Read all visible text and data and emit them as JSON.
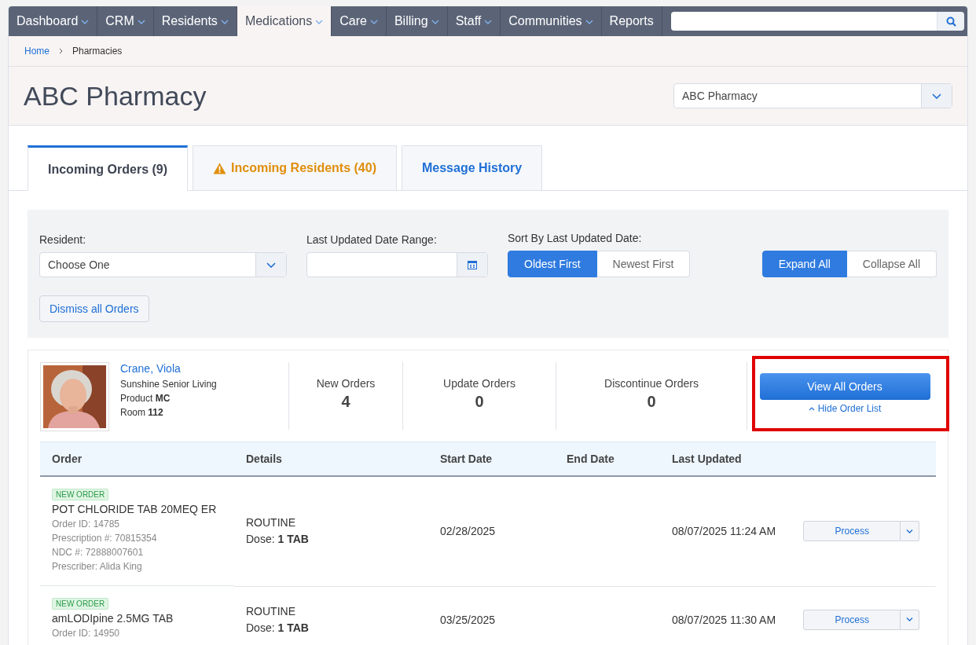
{
  "nav": {
    "items": [
      {
        "label": "Dashboard",
        "dropdown": true,
        "selected": false
      },
      {
        "label": "CRM",
        "dropdown": true,
        "selected": false
      },
      {
        "label": "Residents",
        "dropdown": true,
        "selected": false
      },
      {
        "label": "Medications",
        "dropdown": true,
        "selected": true
      },
      {
        "label": "Care",
        "dropdown": true,
        "selected": false
      },
      {
        "label": "Billing",
        "dropdown": true,
        "selected": false
      },
      {
        "label": "Staff",
        "dropdown": true,
        "selected": false
      },
      {
        "label": "Communities",
        "dropdown": true,
        "selected": false
      },
      {
        "label": "Reports",
        "dropdown": false,
        "selected": false
      }
    ]
  },
  "breadcrumb": [
    "Home",
    "Pharmacies"
  ],
  "page_title": "ABC Pharmacy",
  "pharmacy_select": {
    "value": "ABC Pharmacy"
  },
  "tabs": [
    {
      "label": "Incoming Orders (9)",
      "kind": "plain",
      "selected": true
    },
    {
      "label": "Incoming Residents (40)",
      "kind": "warning",
      "selected": false
    },
    {
      "label": "Message History",
      "kind": "plain",
      "selected": false
    }
  ],
  "filters": {
    "resident": {
      "label": "Resident:",
      "value": "Choose One"
    },
    "date_range": {
      "label": "Last Updated Date Range:"
    },
    "sort": {
      "label": "Sort By Last Updated Date:",
      "options": [
        {
          "label": "Oldest First",
          "selected": true
        },
        {
          "label": "Newest First",
          "selected": false
        }
      ]
    },
    "expand": [
      {
        "label": "Expand All",
        "selected": true
      },
      {
        "label": "Collapse All",
        "selected": false
      }
    ],
    "dismiss_button": "Dismiss all Orders"
  },
  "resident": {
    "name": "Crane, Viola",
    "community": "Sunshine Senior Living",
    "product": "Product **MC**",
    "room": "Room **112**",
    "counts": [
      {
        "label": "New Orders",
        "value": "4"
      },
      {
        "label": "Update Orders",
        "value": "0"
      },
      {
        "label": "Discontinue Orders",
        "value": "0"
      }
    ],
    "view_button": "View All Orders",
    "hide_link": "Hide Order List",
    "highlighted": true
  },
  "table": {
    "columns": [
      "Order",
      "Details",
      "Start Date",
      "End Date",
      "Last Updated"
    ],
    "rows": [
      {
        "badge": "NEW ORDER",
        "drug": "POT CHLORIDE TAB 20MEQ ER",
        "meta": [
          "Order ID: 14785",
          "Prescription #: 70815354",
          "NDC #: 72888007601",
          "Prescriber: Alida King"
        ],
        "priority": "ROUTINE",
        "dose": "Dose: **1 TAB**",
        "start": "02/28/2025",
        "updated": "08/07/2025 11:24 AM",
        "action": "Process"
      },
      {
        "badge": "NEW ORDER",
        "drug": "amLODIpine 2.5MG TAB",
        "meta": [
          "Order ID: 14950"
        ],
        "priority": "ROUTINE",
        "dose": "Dose: **1 TAB**",
        "start": "03/25/2025",
        "updated": "08/07/2025 11:30 AM",
        "action": "Process"
      }
    ]
  }
}
